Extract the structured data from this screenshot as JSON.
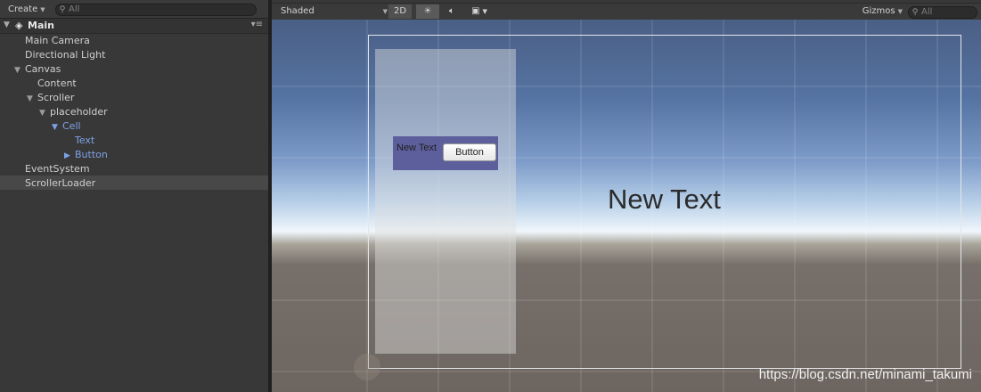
{
  "hierarchy": {
    "create_label": "Create",
    "search_placeholder": "All",
    "scene_name": "Main",
    "items": [
      {
        "label": "Main Camera"
      },
      {
        "label": "Directional Light"
      },
      {
        "label": "Canvas"
      },
      {
        "label": "Content"
      },
      {
        "label": "Scroller"
      },
      {
        "label": "placeholder"
      },
      {
        "label": "Cell"
      },
      {
        "label": "Text"
      },
      {
        "label": "Button"
      },
      {
        "label": "EventSystem"
      },
      {
        "label": "ScrollerLoader"
      }
    ],
    "selected_item": "ScrollerLoader"
  },
  "scene_toolbar": {
    "shading_mode": "Shaded",
    "mode_2d_label": "2D",
    "gizmos_label": "Gizmos",
    "search_placeholder": "All"
  },
  "scene_view": {
    "cell_text": "New Text",
    "cell_button_label": "Button",
    "big_text": "New Text",
    "watermark": "https://blog.csdn.net/minami_takumi"
  },
  "colors": {
    "tree_highlight": "#7ea2e6",
    "cell_background": "#5d5f9c",
    "panel_background": "#383838"
  }
}
